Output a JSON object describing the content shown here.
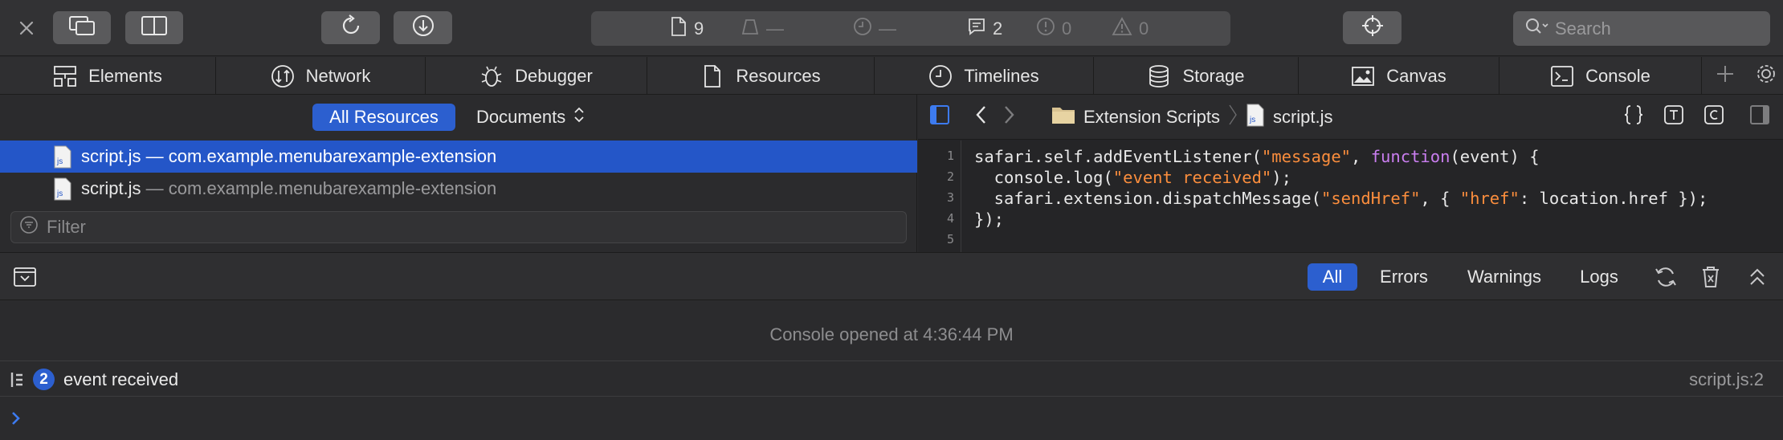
{
  "toolbar": {
    "status": {
      "resources_count": "9",
      "load_size": "—",
      "load_time": "—",
      "log_count": "2",
      "error_count": "0",
      "warning_count": "0"
    },
    "search_placeholder": "Search"
  },
  "tabs": [
    {
      "label": "Elements",
      "icon": "elements-icon"
    },
    {
      "label": "Network",
      "icon": "network-icon"
    },
    {
      "label": "Debugger",
      "icon": "debugger-icon"
    },
    {
      "label": "Resources",
      "icon": "resources-icon"
    },
    {
      "label": "Timelines",
      "icon": "timelines-icon"
    },
    {
      "label": "Storage",
      "icon": "storage-icon"
    },
    {
      "label": "Canvas",
      "icon": "canvas-icon"
    },
    {
      "label": "Console",
      "icon": "console-icon"
    }
  ],
  "resources": {
    "scope_all": "All Resources",
    "scope_docs": "Documents",
    "items": [
      {
        "file": "script.js",
        "sep": " — ",
        "origin": "com.example.menubarexample-extension",
        "selected": true
      },
      {
        "file": "script.js",
        "sep": " — ",
        "origin": "com.example.menubarexample-extension",
        "selected": false
      }
    ],
    "filter_placeholder": "Filter"
  },
  "editor": {
    "breadcrumb_folder": "Extension Scripts",
    "breadcrumb_file": "script.js",
    "line_numbers": [
      "1",
      "2",
      "3",
      "4",
      "5"
    ],
    "lines": [
      [
        {
          "t": "safari.self.addEventListener("
        },
        {
          "t": "\"message\"",
          "c": "str"
        },
        {
          "t": ", "
        },
        {
          "t": "function",
          "c": "kw"
        },
        {
          "t": "(event) {"
        }
      ],
      [
        {
          "t": "  console.log("
        },
        {
          "t": "\"event received\"",
          "c": "str"
        },
        {
          "t": ");"
        }
      ],
      [
        {
          "t": "  safari.extension.dispatchMessage("
        },
        {
          "t": "\"sendHref\"",
          "c": "str"
        },
        {
          "t": ", { "
        },
        {
          "t": "\"href\"",
          "c": "str"
        },
        {
          "t": ": location.href });"
        }
      ],
      [
        {
          "t": "});"
        }
      ],
      [
        {
          "t": ""
        }
      ]
    ]
  },
  "console": {
    "filters": {
      "all": "All",
      "errors": "Errors",
      "warnings": "Warnings",
      "logs": "Logs"
    },
    "session_text": "Console opened at 4:36:44 PM",
    "message": {
      "count": "2",
      "text": "event received",
      "source": "script.js:2"
    }
  },
  "colors": {
    "accent": "#2c5fcf",
    "string": "#fc8e3d",
    "keyword": "#ca7ef0"
  }
}
